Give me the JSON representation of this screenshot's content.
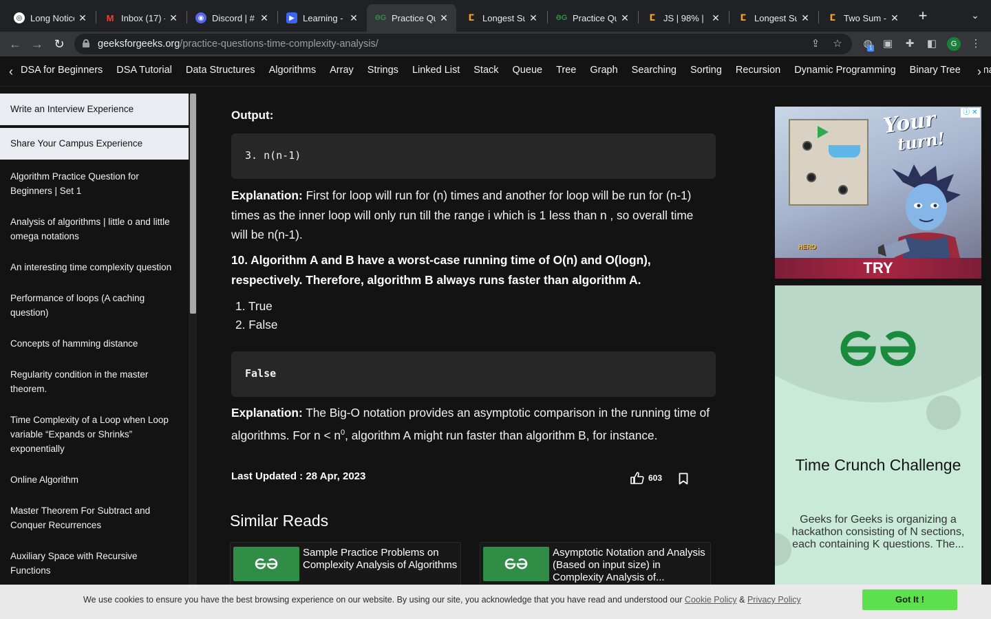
{
  "browser": {
    "tabs": [
      {
        "title": "Long Notice",
        "icon": "chatgpt-icon",
        "color": "#ffffff"
      },
      {
        "title": "Inbox (17) -",
        "icon": "gmail-icon",
        "color": "#ea4335"
      },
      {
        "title": "Discord | #",
        "icon": "discord-icon",
        "color": "#5865f2"
      },
      {
        "title": "Learning -",
        "icon": "learning-icon",
        "color": "#3b63f5"
      },
      {
        "title": "Practice Qu",
        "icon": "gfg-icon",
        "color": "#2f8d46"
      },
      {
        "title": "Longest Sul",
        "icon": "leetcode-icon",
        "color": "#ffa116"
      },
      {
        "title": "Practice Qu",
        "icon": "gfg-icon",
        "color": "#2f8d46"
      },
      {
        "title": "JS | 98% |",
        "icon": "leetcode-icon",
        "color": "#ffa116"
      },
      {
        "title": "Longest Sul",
        "icon": "leetcode-icon",
        "color": "#ffa116"
      },
      {
        "title": "Two Sum -",
        "icon": "leetcode-icon",
        "color": "#ffa116"
      }
    ],
    "active_tab_index": 4,
    "url_host": "geeksforgeeks.org",
    "url_path": "/practice-questions-time-complexity-analysis/",
    "profile_initial": "G",
    "extension_badge": "1"
  },
  "catnav": {
    "items": [
      "DSA for Beginners",
      "DSA Tutorial",
      "Data Structures",
      "Algorithms",
      "Array",
      "Strings",
      "Linked List",
      "Stack",
      "Queue",
      "Tree",
      "Graph",
      "Searching",
      "Sorting",
      "Recursion",
      "Dynamic Programming",
      "Binary Tree",
      "Binary Search"
    ]
  },
  "sidebar": {
    "items": [
      {
        "label": "Write an Interview Experience",
        "light": true
      },
      {
        "label": "Share Your Campus Experience",
        "light": true
      },
      {
        "label": "Algorithm Practice Question for Beginners | Set 1"
      },
      {
        "label": "Analysis of algorithms | little o and little omega notations"
      },
      {
        "label": "An interesting time complexity question"
      },
      {
        "label": "Performance of loops (A caching question)"
      },
      {
        "label": "Concepts of hamming distance"
      },
      {
        "label": "Regularity condition in the master theorem."
      },
      {
        "label": "Time Complexity of a Loop when Loop variable “Expands or Shrinks” exponentially"
      },
      {
        "label": "Online Algorithm"
      },
      {
        "label": "Master Theorem For Subtract and Conquer Recurrences"
      },
      {
        "label": "Auxiliary Space with Recursive Functions"
      }
    ]
  },
  "article": {
    "output_label": "Output:",
    "code1": "3. n(n-1)",
    "explanation1_label": "Explanation:",
    "explanation1_text": " First for loop will run for (n) times and another for loop will be run for (n-1) times as the inner loop will only run till the range i which is 1 less than n , so overall time will be n(n-1).",
    "question10": "10.  Algorithm A and B have a worst-case running time of O(n) and O(logn), respectively. Therefore, algorithm B always runs faster than algorithm A.",
    "options": [
      "1. True",
      "2. False"
    ],
    "code2": "False",
    "explanation2_label": "Explanation:",
    "explanation2_text_a": " The Big-O notation provides an asymptotic comparison in the running time of algorithms. For n < n",
    "explanation2_sup": "0",
    "explanation2_text_b": ", algorithm A might run faster than algorithm B, for instance.",
    "last_updated": "Last Updated : 28 Apr, 2023",
    "likes": "603",
    "similar_reads_title": "Similar Reads",
    "similar_reads": [
      {
        "title": "Sample Practice Problems on Complexity Analysis of Algorithms"
      },
      {
        "title": "Asymptotic Notation and Analysis (Based on input size) in Complexity Analysis of..."
      }
    ]
  },
  "ads": {
    "game_headline_1": "Your",
    "game_headline_2": "turn!",
    "game_brand": "HERO WARS",
    "game_cta": "TRY",
    "promo_title": "Time Crunch Challenge",
    "promo_desc": "Geeks for Geeks is organizing a hackathon consisting of N sections, each containing K questions. The..."
  },
  "cookie": {
    "message": "We use cookies to ensure you have the best browsing experience on our website. By using our site, you acknowledge that you have read and understood our ",
    "cookie_policy": "Cookie Policy",
    "and": " & ",
    "privacy_policy": "Privacy Policy",
    "button": "Got It !"
  },
  "colors": {
    "gfg_green": "#2f8d46",
    "page_bg": "#131313",
    "code_bg": "#272727",
    "cookie_button": "#5ce04d"
  }
}
